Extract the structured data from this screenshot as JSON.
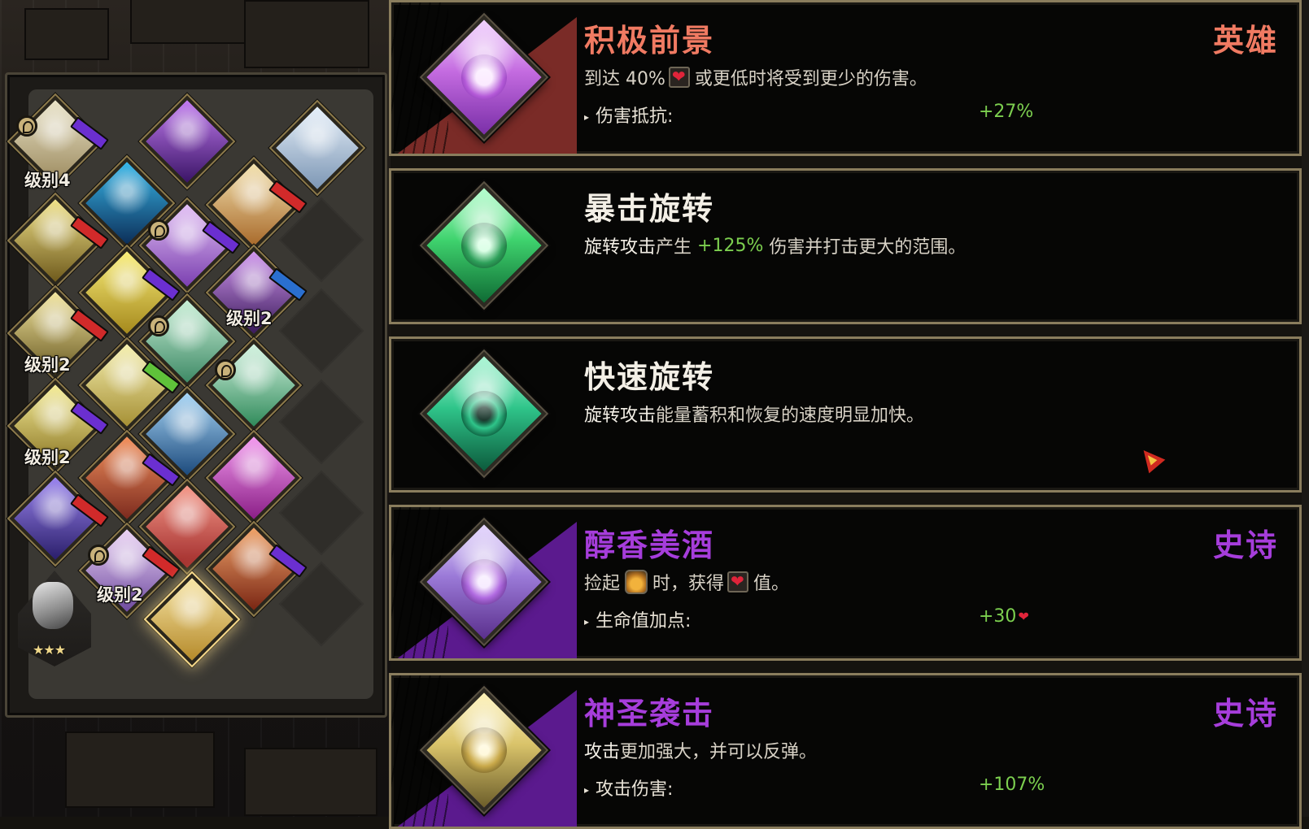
{
  "board": {
    "level_labels": [
      "级别4",
      "级别2",
      "级别2",
      "级别2",
      "级别2"
    ],
    "keepsake_stars": "★★★"
  },
  "boons": [
    {
      "title": "积极前景",
      "rarity": "英雄",
      "rarity_color": "#f07a62",
      "title_color": "#f07a62",
      "triangle_color": "#7a2b27",
      "icon_colors": [
        "#c46be0",
        "#7a2fa8",
        "#f2d2ff"
      ],
      "icon": "sun-sigil-icon",
      "desc_parts": [
        "到达 40%",
        "或更低时将受到更少的伤害。"
      ],
      "stat_label": "伤害抵抗:",
      "stat_value": "+27%"
    },
    {
      "title": "暴击旋转",
      "rarity": "",
      "title_color": "#f3efe6",
      "icon_colors": [
        "#3fd36e",
        "#0f6b34",
        "#b6ffcf"
      ],
      "icon": "spin-blade-icon",
      "desc_highlight": "旋转攻击",
      "desc_mid": "产生 ",
      "desc_green": "+125%",
      "desc_tail": " 伤害并打击更大的范围。"
    },
    {
      "title": "快速旋转",
      "rarity": "",
      "title_color": "#f3efe6",
      "icon_colors": [
        "#2fc58a",
        "#0c5a3c",
        "#aef7d6"
      ],
      "icon": "spin-vortex-icon",
      "desc_highlight": "旋转攻击",
      "desc_tail": "能量蓄积和恢复的速度明显加快。"
    },
    {
      "title": "醇香美酒",
      "rarity": "史诗",
      "rarity_color": "#a63ddb",
      "title_color": "#a63ddb",
      "triangle_color": "#5b1a8e",
      "icon_colors": [
        "#9b7ad8",
        "#5a2f8c",
        "#e6d8ff"
      ],
      "icon": "wine-bubble-icon",
      "desc_parts": [
        "捡起",
        "时，获得",
        "值。"
      ],
      "stat_label": "生命值加点:",
      "stat_value": "+30"
    },
    {
      "title": "神圣袭击",
      "rarity": "史诗",
      "rarity_color": "#a63ddb",
      "title_color": "#a63ddb",
      "triangle_color": "#5b1a8e",
      "icon_colors": [
        "#d9c36a",
        "#6b5d2a",
        "#fff3b8"
      ],
      "icon": "holy-strike-icon",
      "desc_highlight": "攻击",
      "desc_tail": "更加强大，并可以反弹。",
      "stat_label": "攻击伤害:",
      "stat_value": "+107%"
    }
  ]
}
